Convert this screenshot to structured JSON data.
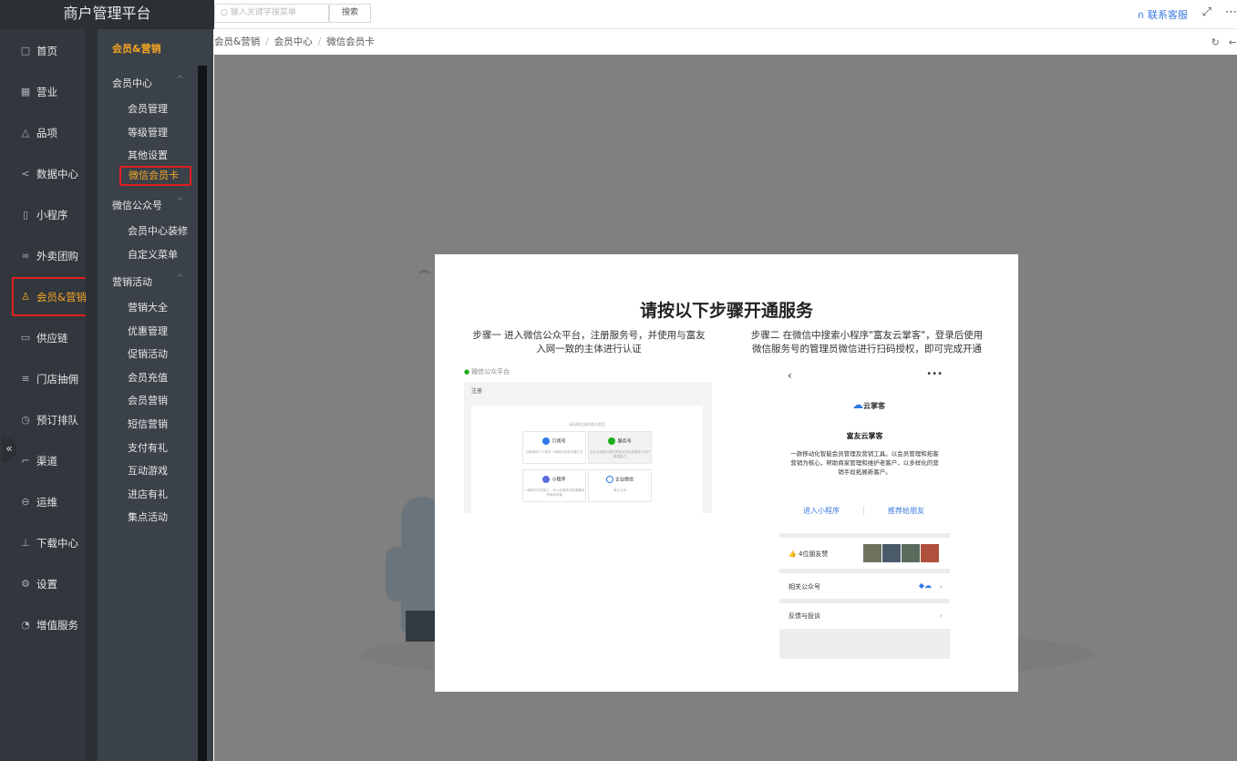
{
  "app": {
    "title": "商户管理平台"
  },
  "nav": {
    "items": [
      {
        "label": "首页",
        "icon": "home-icon",
        "glyph": "□"
      },
      {
        "label": "营业",
        "icon": "calendar-icon",
        "glyph": "▦"
      },
      {
        "label": "品项",
        "icon": "bag-icon",
        "glyph": "△"
      },
      {
        "label": "数据中心",
        "icon": "share-icon",
        "glyph": "<"
      },
      {
        "label": "小程序",
        "icon": "phone-icon",
        "glyph": "▯"
      },
      {
        "label": "外卖团购",
        "icon": "bike-icon",
        "glyph": "∞"
      },
      {
        "label": "会员&营销",
        "icon": "user-icon",
        "glyph": "♙"
      },
      {
        "label": "供应链",
        "icon": "truck-icon",
        "glyph": "▭"
      },
      {
        "label": "门店抽佣",
        "icon": "database-icon",
        "glyph": "≡"
      },
      {
        "label": "预订排队",
        "icon": "clock-icon",
        "glyph": "◷"
      },
      {
        "label": "渠道",
        "icon": "crop-icon",
        "glyph": "⌐"
      },
      {
        "label": "运维",
        "icon": "wrench-icon",
        "glyph": "⊖"
      },
      {
        "label": "下载中心",
        "icon": "download-icon",
        "glyph": "⊥"
      },
      {
        "label": "设置",
        "icon": "gear-icon",
        "glyph": "⚙"
      },
      {
        "label": "增值服务",
        "icon": "alarm-icon",
        "glyph": "◔"
      }
    ]
  },
  "submenu": {
    "title": "会员&营销",
    "groups": [
      {
        "label": "会员中心",
        "items": [
          "会员管理",
          "等级管理",
          "其他设置",
          "微信会员卡"
        ]
      },
      {
        "label": "微信公众号",
        "items": [
          "会员中心装修",
          "自定义菜单"
        ]
      },
      {
        "label": "营销活动",
        "items": [
          "营销大全",
          "优惠管理",
          "促销活动",
          "会员充值",
          "会员营销",
          "短信营销",
          "支付有礼",
          "互动游戏",
          "进店有礼",
          "集点活动"
        ]
      }
    ]
  },
  "topbar": {
    "search_placeholder": "输入关键字搜菜单",
    "search_button": "搜索",
    "support": "联系客服"
  },
  "breadcrumb": [
    "会员&营销",
    "会员中心",
    "微信会员卡"
  ],
  "modal": {
    "title": "请按以下步骤开通服务",
    "step1_line1": "步骤一 进入微信公众平台，注册服务号，并使用与富友",
    "step1_line2": "入网一致的主体进行认证",
    "step2_line1": "步骤二 在微信中搜索小程序\"富友云掌客\"，登录后使用",
    "step2_line2": "微信服务号的管理员微信进行扫码授权，即可完成开通",
    "wx_platform": {
      "header": "微信公众平台",
      "bar": "注册",
      "caption": "请选择注册的账号类型",
      "cards": [
        {
          "label": "订阅号",
          "desc": "为媒体和个人提供一种新的信息传播方式",
          "color": "#2b78e4"
        },
        {
          "label": "服务号",
          "desc": "为企业和组织提供更强大的业务服务与用户管理能力",
          "color": "#1aad19"
        },
        {
          "label": "小程序",
          "desc": "一种新的开放能力，可以在微信内被便捷地获取和传播",
          "color": "#5b6ee1"
        },
        {
          "label": "企业微信",
          "desc": "原企业号",
          "color": "#2b78e4"
        }
      ]
    },
    "mini_program": {
      "logo_text": "云掌客",
      "name": "富友云掌客",
      "desc": "一款移动化智能会员管理及营销工具。以会员管理和拓客营销为核心，帮助商家管理和维护老客户，以多样化的营销手段拓展新客户。",
      "enter": "进入小程序",
      "recommend": "推荐给朋友",
      "likes": "4位朋友赞",
      "related": "相关公众号",
      "feedback": "反馈与投诉"
    }
  }
}
